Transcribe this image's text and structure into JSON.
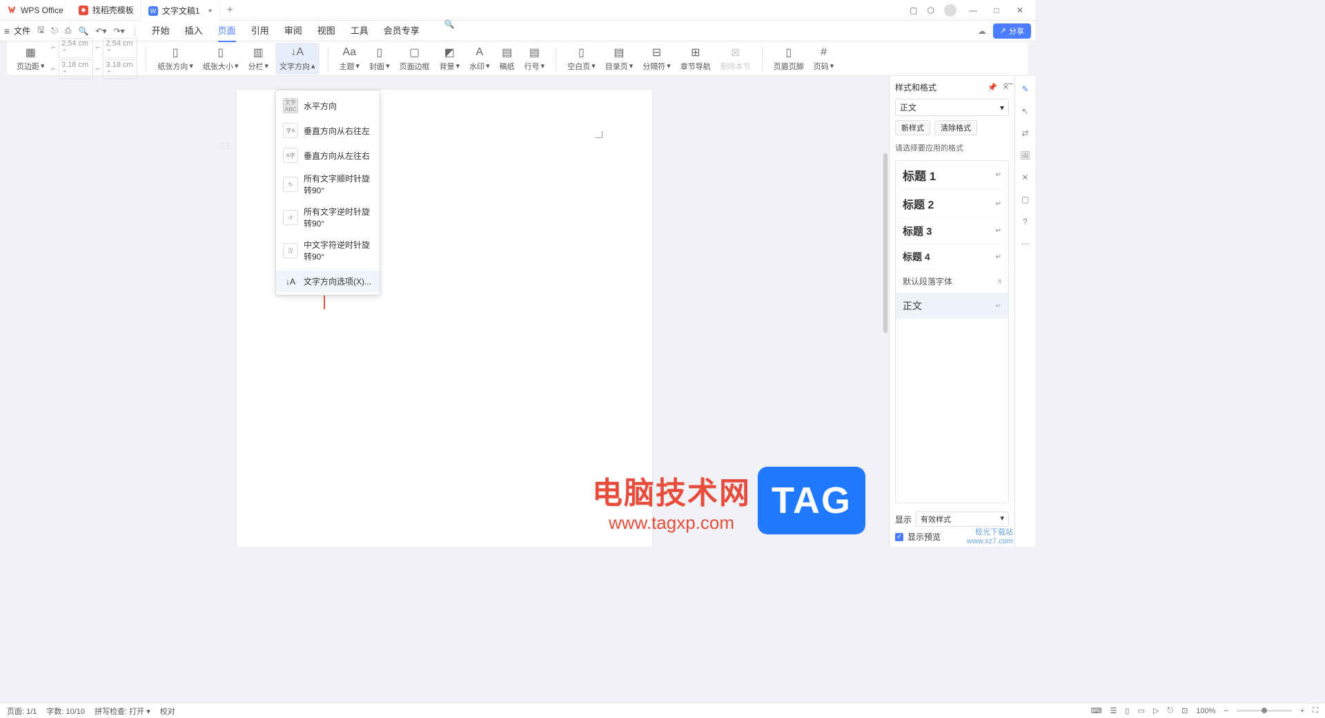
{
  "titlebar": {
    "app_name": "WPS Office",
    "tabs": [
      {
        "label": "找稻壳模板",
        "icon": "red"
      },
      {
        "label": "文字文稿1",
        "icon": "blue"
      }
    ]
  },
  "menubar": {
    "file": "文件",
    "tabs": [
      "开始",
      "插入",
      "页面",
      "引用",
      "审阅",
      "视图",
      "工具",
      "会员专享"
    ],
    "active_index": 2,
    "share": "分享"
  },
  "ribbon": {
    "margins": {
      "top": "2.54",
      "bottom": "2.54",
      "left": "3.18",
      "right": "3.18",
      "unit": "cm"
    },
    "items": {
      "page_margin": "页边距",
      "paper_dir": "纸张方向",
      "paper_size": "纸张大小",
      "columns": "分栏",
      "text_dir": "文字方向",
      "theme": "主题",
      "cover": "封面",
      "page_border": "页面边框",
      "background": "背景",
      "watermark": "水印",
      "writing_paper": "稿纸",
      "line_no": "行号",
      "blank_page": "空白页",
      "toc_page": "目录页",
      "separator": "分隔符",
      "chapter_nav": "章节导航",
      "delete_section": "删除本节",
      "header_footer": "页眉页脚",
      "page_no": "页码"
    }
  },
  "dropdown": {
    "items": [
      "水平方向",
      "垂直方向从右往左",
      "垂直方向从左往右",
      "所有文字顺时针旋转90°",
      "所有文字逆时针旋转90°",
      "中文字符逆时针旋转90°"
    ],
    "options": "文字方向选项(X)..."
  },
  "styles_panel": {
    "title": "样式和格式",
    "current": "正文",
    "new_style": "新样式",
    "clear_format": "清除格式",
    "hint": "请选择要应用的格式",
    "styles": [
      {
        "label": "标题 1",
        "class": "h1"
      },
      {
        "label": "标题 2",
        "class": "h2"
      },
      {
        "label": "标题 3",
        "class": "h3"
      },
      {
        "label": "标题 4",
        "class": "h4"
      },
      {
        "label": "默认段落字体",
        "class": "small"
      },
      {
        "label": "正文",
        "class": "selected"
      }
    ],
    "display_label": "显示",
    "display_value": "有效样式",
    "preview": "显示预览"
  },
  "statusbar": {
    "page": "页面: 1/1",
    "words": "字数: 10/10",
    "spell": "拼写检查: 打开",
    "proof": "校对",
    "zoom": "100%"
  },
  "watermark": {
    "line1": "电脑技术网",
    "line2": "www.tagxp.com",
    "tag": "TAG",
    "corner1": "极光下载站",
    "corner2": "www.xz7.com"
  }
}
